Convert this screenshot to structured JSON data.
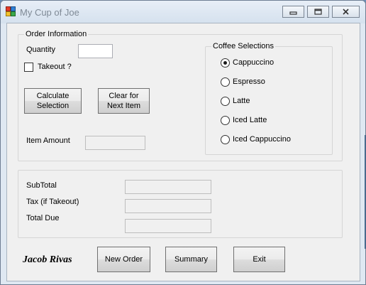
{
  "window": {
    "title": "My Cup of Joe",
    "icon": "app-window-icon",
    "controls": {
      "minimize": "minimize-icon",
      "maximize": "maximize-icon",
      "close": "close-icon"
    }
  },
  "order_info": {
    "legend": "Order Information",
    "quantity_label": "Quantity",
    "quantity_value": "",
    "takeout_label": "Takeout ?",
    "takeout_checked": false,
    "calculate_button": "Calculate\nSelection",
    "clear_button": "Clear for\nNext Item",
    "item_amount_label": "Item Amount",
    "item_amount_value": ""
  },
  "coffee": {
    "legend": "Coffee Selections",
    "options": [
      {
        "label": "Cappuccino",
        "checked": true
      },
      {
        "label": "Espresso",
        "checked": false
      },
      {
        "label": "Latte",
        "checked": false
      },
      {
        "label": "Iced Latte",
        "checked": false
      },
      {
        "label": "Iced Cappuccino",
        "checked": false
      }
    ]
  },
  "totals": {
    "subtotal_label": "SubTotal",
    "subtotal_value": "",
    "tax_label": "Tax (if Takeout)",
    "tax_value": "",
    "total_label": "Total Due",
    "total_value": ""
  },
  "footer": {
    "author": "Jacob Rivas",
    "new_order_button": "New Order",
    "summary_button": "Summary",
    "exit_button": "Exit"
  },
  "colors": {
    "client_bg": "#f0f0f0",
    "title_text": "#7f8a96"
  }
}
